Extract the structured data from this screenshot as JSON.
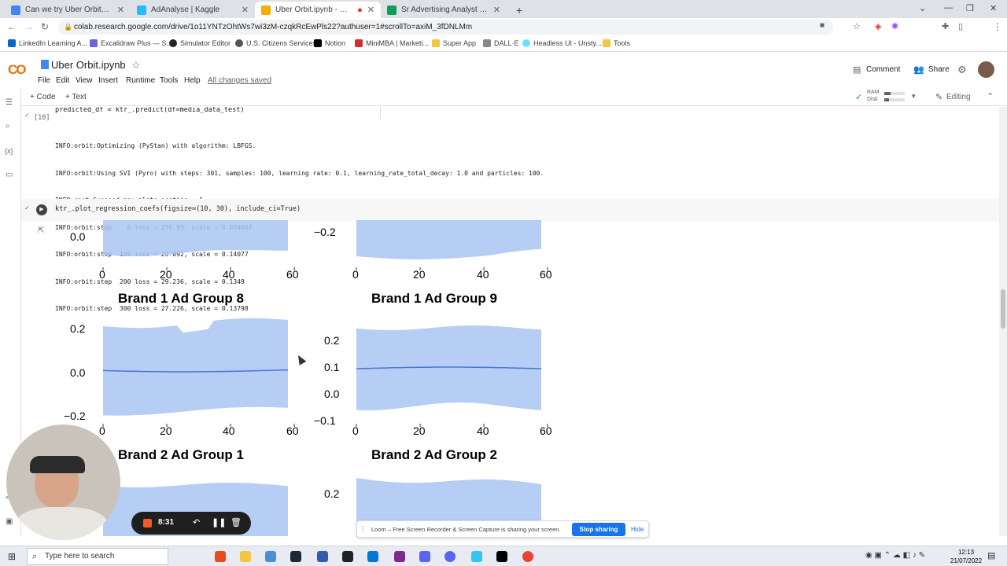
{
  "browser": {
    "tabs": [
      {
        "title": "Can we try Uber Orbit? – Autom",
        "color": "#4285f4",
        "active": false
      },
      {
        "title": "AdAnalyse | Kaggle",
        "color": "#20beff",
        "active": false
      },
      {
        "title": "Uber Orbit.ipynb - Colabora",
        "color": "#f9ab00",
        "active": true
      },
      {
        "title": "Sr Advertising Analyst Work Sam",
        "color": "#0f9d58",
        "active": false
      }
    ],
    "new_tab": "+",
    "url": "colab.research.google.com/drive/1o11YNTzOhtWs7wi3zM-czqkRcEwPls22?authuser=1#scrollTo=axiM_3fDNLMm",
    "bookmarks": [
      {
        "label": "LinkedIn Learning A...",
        "color": "#0a66c2"
      },
      {
        "label": "Excalidraw Plus — S...",
        "color": "#6965db"
      },
      {
        "label": "Simulator Editor",
        "color": "#222222"
      },
      {
        "label": "U.S. Citizens Services",
        "color": "#555555"
      },
      {
        "label": "Notion",
        "color": "#000000"
      },
      {
        "label": "MiniMBA | Marketi...",
        "color": "#d32f2f"
      },
      {
        "label": "Super App",
        "color": "#f6c343"
      },
      {
        "label": "DALL·E",
        "color": "#888888"
      },
      {
        "label": "Headless UI - Unsty...",
        "color": "#66e3ff"
      },
      {
        "label": "Tools",
        "color": "#f4c542"
      }
    ]
  },
  "colab": {
    "logo_text": "CO",
    "notebook_title": "Uber Orbit.ipynb",
    "menu": [
      "File",
      "Edit",
      "View",
      "Insert",
      "Runtime",
      "Tools",
      "Help"
    ],
    "saved_status": "All changes saved",
    "comment_label": "Comment",
    "share_label": "Share",
    "add_code": "+ Code",
    "add_text": "+ Text",
    "ram_label": "RAM",
    "disk_label": "Disk",
    "editing_label": "Editing"
  },
  "cells": {
    "cell1_code": "predicted_df = ktr_.predict(df=media_data_test)",
    "cell1_exec": "[10]",
    "cell1_output": [
      "INFO:orbit:Optimizing (PyStan) with algorithm: LBFGS.",
      "INFO:orbit:Using SVI (Pyro) with steps: 301, samples: 100, learning rate: 0.1, learning_rate_total_decay: 1.0 and particles: 100.",
      "INFO:root:Guessed max_plate_nesting = 1",
      "INFO:orbit:step    0 loss = 276.93, scale = 0.094667",
      "INFO:orbit:step  100 loss = 25.092, scale = 0.14077",
      "INFO:orbit:step  200 loss = 29.236, scale = 0.1349",
      "INFO:orbit:step  300 loss = 27.226, scale = 0.13798"
    ],
    "cell2_code": "ktr_.plot_regression_coefs(figsize=(10, 30), include_ci=True)"
  },
  "chart_data": [
    {
      "type": "area",
      "title": "",
      "x_ticks": [
        "0",
        "20",
        "40",
        "60"
      ],
      "y_ticks": [
        "0.0"
      ]
    },
    {
      "type": "area",
      "title": "",
      "x_ticks": [
        "0",
        "20",
        "40",
        "60"
      ],
      "y_ticks": [
        "−0.2"
      ]
    },
    {
      "type": "line",
      "title": "Brand 1 Ad Group 8",
      "x_ticks": [
        "0",
        "20",
        "40",
        "60"
      ],
      "y_ticks": [
        "0.2",
        "0.0",
        "−0.2"
      ],
      "xlim": [
        0,
        58
      ],
      "ylim": [
        -0.22,
        0.22
      ]
    },
    {
      "type": "line",
      "title": "Brand 1 Ad Group 9",
      "x_ticks": [
        "0",
        "20",
        "40",
        "60"
      ],
      "y_ticks": [
        "0.2",
        "0.1",
        "0.0",
        "−0.1"
      ],
      "xlim": [
        0,
        58
      ],
      "ylim": [
        -0.1,
        0.25
      ]
    },
    {
      "type": "area",
      "title": "Brand 2 Ad Group 1",
      "x_ticks": [],
      "y_ticks": []
    },
    {
      "type": "area",
      "title": "Brand 2 Ad Group 2",
      "x_ticks": [],
      "y_ticks": [
        "0.2"
      ]
    }
  ],
  "loom": {
    "message": "Loom – Free Screen Recorder & Screen Capture is sharing your screen.",
    "stop_label": "Stop sharing",
    "hide_label": "Hide",
    "timer": "8:31"
  },
  "taskbar": {
    "search_placeholder": "Type here to search",
    "time": "12:13",
    "date": "21/07/2022"
  }
}
